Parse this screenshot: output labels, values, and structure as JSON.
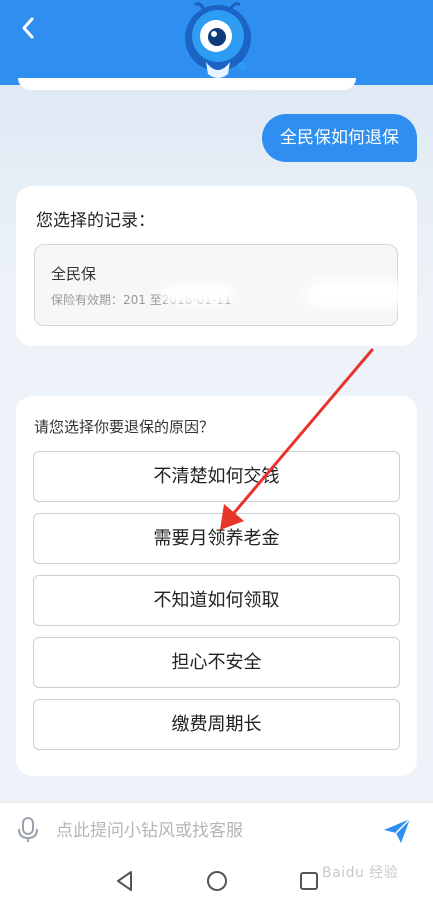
{
  "chat": {
    "user_message": "全民保如何退保",
    "record_card": {
      "title": "您选择的记录：",
      "name": "全民保",
      "validity": "保险有效期：201        至2018-01-11"
    },
    "reason_card": {
      "question": "请您选择你要退保的原因？",
      "options": [
        "不清楚如何交钱",
        "需要月领养老金",
        "不知道如何领取",
        "担心不安全",
        "缴费周期长"
      ]
    }
  },
  "input_bar": {
    "placeholder": "点此提问小钻风或找客服"
  },
  "watermark": {
    "text": "Baidu 经验"
  },
  "colors": {
    "brand_blue": "#2f8ff0",
    "annotation_red": "#e8352c"
  }
}
